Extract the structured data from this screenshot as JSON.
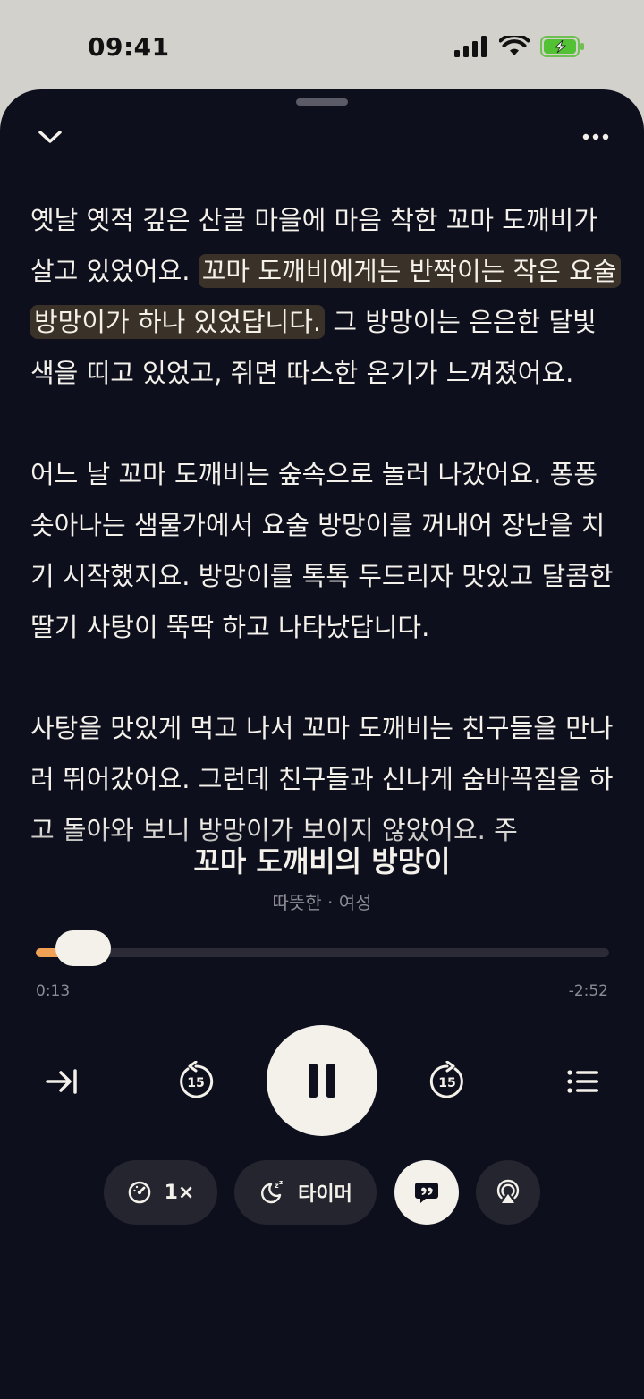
{
  "status_bar": {
    "time": "09:41"
  },
  "story": {
    "paragraphs": [
      {
        "before": "옛날 옛적 깊은 산골 마을에 마음 착한 꼬마 도깨비가 살고 있었어요. ",
        "highlight": "꼬마 도깨비에게는 반짝이는 작은 요술 방망이가 하나 있었답니다.",
        "after": " 그 방망이는 은은한 달빛 색을 띠고 있었고, 쥐면 따스한 온기가 느껴졌어요."
      },
      {
        "before": "어느 날 꼬마 도깨비는 숲속으로 놀러 나갔어요. 퐁퐁 솟아나는 샘물가에서 요술 방망이를 꺼내어 장난을 치기 시작했지요. 방망이를 톡톡 두드리자 맛있고 달콤한 딸기 사탕이 뚝딱 하고 나타났답니다.",
        "highlight": "",
        "after": ""
      },
      {
        "before": "사탕을 맛있게 먹고 나서 꼬마 도깨비는 친구들을 만나러 뛰어갔어요. 그런데 친구들과 신나게 숨바꼭질을 하고 돌아와 보니 방망이가 보이지 않았어요. 주",
        "highlight": "",
        "after": ""
      }
    ]
  },
  "player": {
    "title": "꼬마 도깨비의 방망이",
    "subtitle": "따뜻한 · 여성",
    "elapsed": "0:13",
    "remaining": "-2:52",
    "progress_fraction": 0.07,
    "accent_color": "#f0a156"
  },
  "controls": {
    "skip_icon": "skip-to-end-icon",
    "rewind_icon": "rewind-15-icon",
    "rewind_label": "15",
    "play_state_icon": "pause-icon",
    "forward_icon": "forward-15-icon",
    "forward_label": "15",
    "list_icon": "playlist-icon"
  },
  "options": {
    "speed_label": "1×",
    "timer_label": "타이머",
    "speed_icon": "speedometer-icon",
    "timer_icon": "moon-sleep-icon",
    "caption_icon": "quote-bubble-icon",
    "airplay_icon": "airplay-icon"
  }
}
